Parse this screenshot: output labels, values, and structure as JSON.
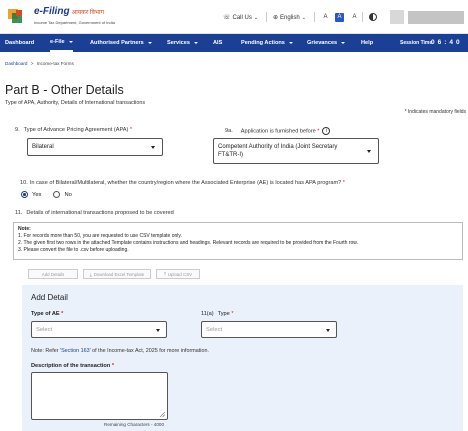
{
  "header": {
    "logo_title": "e-Filing",
    "logo_hindi": "आयकर विभाग",
    "logo_sub": "Income Tax Department, Government of India",
    "call_us": "Call Us",
    "language": "English",
    "font_decrease": "A",
    "font_default": "A",
    "font_increase": "A"
  },
  "nav": {
    "items": [
      {
        "label": "Dashboard"
      },
      {
        "label": "e-File"
      },
      {
        "label": "Authorised Partners"
      },
      {
        "label": "Services"
      },
      {
        "label": "AIS"
      },
      {
        "label": "Pending Actions"
      },
      {
        "label": "Grievances"
      },
      {
        "label": "Help"
      }
    ],
    "session_label": "Session Time",
    "session_time": "06:40"
  },
  "breadcrumb": {
    "home": "Dashboard",
    "sep": ">",
    "current": "Income-tax Forms"
  },
  "page": {
    "title": "Part B - Other Details",
    "subtitle": "Type of APA, Authority, Details of International transactions",
    "mandatory": "* Indicates mandatory fields"
  },
  "q9": {
    "num": "9.",
    "label": "Type of Advance Pricing Agreement (APA)",
    "value": "Bilateral"
  },
  "q9a": {
    "num": "9a.",
    "label": "Application is furnished before",
    "value": "Competent Authority of India (Joint Secretary FT&TR-I)"
  },
  "q10": {
    "num": "10.",
    "label": "In case of Bilateral/Multilateral, whether the country/region where the Associated Enterprise (AE) is located has APA program?",
    "yes": "Yes",
    "no": "No"
  },
  "q11": {
    "num": "11.",
    "label": "Details of international transactions proposed to be covered"
  },
  "note": {
    "title": "Note:",
    "lines": [
      "1. For records more than 50, you are requested to use CSV template only.",
      "2. The given first two rows in the attached Template contains instructions and headings. Relevant records are required to be provided from the Fourth row.",
      "3. Please convert the file to .csv before uploading."
    ]
  },
  "actions": {
    "add": "Add Details",
    "download": "Download Excel Template",
    "upload": "Upload CSV"
  },
  "add_detail": {
    "title": "Add Detail",
    "type_ae_label": "Type of AE",
    "type_ae_placeholder": "Select",
    "type_num": "11(a)",
    "type_label": "Type",
    "type_placeholder": "Select",
    "note_prefix": "Note: Refer ",
    "note_link": "'Section 163'",
    "note_suffix": " of the Income-tax Act, 2025 for more information.",
    "desc_label": "Description of the transaction",
    "remaining": "Remaining Characters - 4000"
  },
  "colors": {
    "nav_bg": "#1a3f95",
    "panel_bg": "#eaf1fb",
    "required": "#c62828"
  }
}
